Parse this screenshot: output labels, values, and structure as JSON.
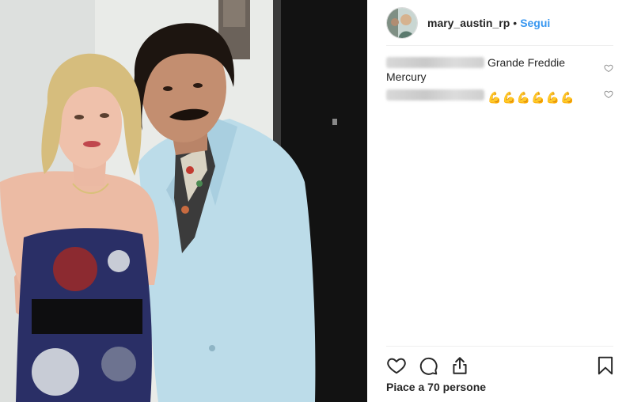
{
  "header": {
    "username": "mary_austin_rp",
    "separator": "•",
    "follow_label": "Segui"
  },
  "comments": [
    {
      "text": "Grande Freddie Mercury",
      "emojis": []
    },
    {
      "text": "",
      "emojis": [
        "💪",
        "💪",
        "💪",
        "💪",
        "💪",
        "💪"
      ]
    }
  ],
  "likes": {
    "text": "Piace a 70 persone"
  },
  "icons": {
    "like": "heart-icon",
    "comment": "comment-icon",
    "share": "share-icon",
    "save": "bookmark-icon",
    "comment_like": "small-heart-icon"
  },
  "colors": {
    "link": "#3897f0",
    "text": "#262626",
    "divider": "#efefef"
  }
}
